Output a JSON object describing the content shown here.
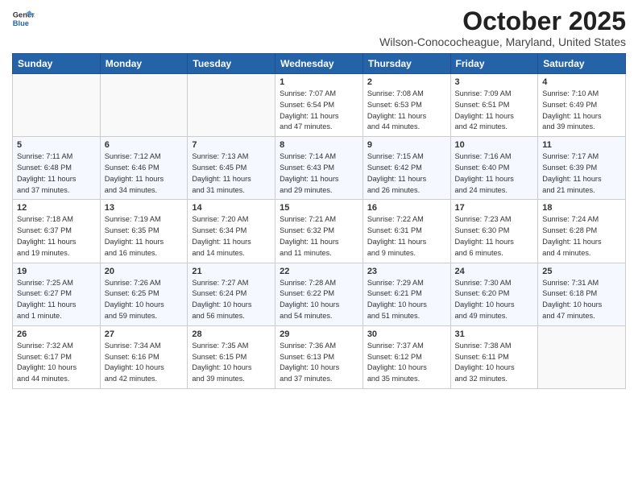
{
  "header": {
    "logo": {
      "line1": "General",
      "line2": "Blue"
    },
    "month": "October 2025",
    "location": "Wilson-Conococheague, Maryland, United States"
  },
  "days_of_week": [
    "Sunday",
    "Monday",
    "Tuesday",
    "Wednesday",
    "Thursday",
    "Friday",
    "Saturday"
  ],
  "weeks": [
    [
      {
        "day": "",
        "info": ""
      },
      {
        "day": "",
        "info": ""
      },
      {
        "day": "",
        "info": ""
      },
      {
        "day": "1",
        "info": "Sunrise: 7:07 AM\nSunset: 6:54 PM\nDaylight: 11 hours\nand 47 minutes."
      },
      {
        "day": "2",
        "info": "Sunrise: 7:08 AM\nSunset: 6:53 PM\nDaylight: 11 hours\nand 44 minutes."
      },
      {
        "day": "3",
        "info": "Sunrise: 7:09 AM\nSunset: 6:51 PM\nDaylight: 11 hours\nand 42 minutes."
      },
      {
        "day": "4",
        "info": "Sunrise: 7:10 AM\nSunset: 6:49 PM\nDaylight: 11 hours\nand 39 minutes."
      }
    ],
    [
      {
        "day": "5",
        "info": "Sunrise: 7:11 AM\nSunset: 6:48 PM\nDaylight: 11 hours\nand 37 minutes."
      },
      {
        "day": "6",
        "info": "Sunrise: 7:12 AM\nSunset: 6:46 PM\nDaylight: 11 hours\nand 34 minutes."
      },
      {
        "day": "7",
        "info": "Sunrise: 7:13 AM\nSunset: 6:45 PM\nDaylight: 11 hours\nand 31 minutes."
      },
      {
        "day": "8",
        "info": "Sunrise: 7:14 AM\nSunset: 6:43 PM\nDaylight: 11 hours\nand 29 minutes."
      },
      {
        "day": "9",
        "info": "Sunrise: 7:15 AM\nSunset: 6:42 PM\nDaylight: 11 hours\nand 26 minutes."
      },
      {
        "day": "10",
        "info": "Sunrise: 7:16 AM\nSunset: 6:40 PM\nDaylight: 11 hours\nand 24 minutes."
      },
      {
        "day": "11",
        "info": "Sunrise: 7:17 AM\nSunset: 6:39 PM\nDaylight: 11 hours\nand 21 minutes."
      }
    ],
    [
      {
        "day": "12",
        "info": "Sunrise: 7:18 AM\nSunset: 6:37 PM\nDaylight: 11 hours\nand 19 minutes."
      },
      {
        "day": "13",
        "info": "Sunrise: 7:19 AM\nSunset: 6:35 PM\nDaylight: 11 hours\nand 16 minutes."
      },
      {
        "day": "14",
        "info": "Sunrise: 7:20 AM\nSunset: 6:34 PM\nDaylight: 11 hours\nand 14 minutes."
      },
      {
        "day": "15",
        "info": "Sunrise: 7:21 AM\nSunset: 6:32 PM\nDaylight: 11 hours\nand 11 minutes."
      },
      {
        "day": "16",
        "info": "Sunrise: 7:22 AM\nSunset: 6:31 PM\nDaylight: 11 hours\nand 9 minutes."
      },
      {
        "day": "17",
        "info": "Sunrise: 7:23 AM\nSunset: 6:30 PM\nDaylight: 11 hours\nand 6 minutes."
      },
      {
        "day": "18",
        "info": "Sunrise: 7:24 AM\nSunset: 6:28 PM\nDaylight: 11 hours\nand 4 minutes."
      }
    ],
    [
      {
        "day": "19",
        "info": "Sunrise: 7:25 AM\nSunset: 6:27 PM\nDaylight: 11 hours\nand 1 minute."
      },
      {
        "day": "20",
        "info": "Sunrise: 7:26 AM\nSunset: 6:25 PM\nDaylight: 10 hours\nand 59 minutes."
      },
      {
        "day": "21",
        "info": "Sunrise: 7:27 AM\nSunset: 6:24 PM\nDaylight: 10 hours\nand 56 minutes."
      },
      {
        "day": "22",
        "info": "Sunrise: 7:28 AM\nSunset: 6:22 PM\nDaylight: 10 hours\nand 54 minutes."
      },
      {
        "day": "23",
        "info": "Sunrise: 7:29 AM\nSunset: 6:21 PM\nDaylight: 10 hours\nand 51 minutes."
      },
      {
        "day": "24",
        "info": "Sunrise: 7:30 AM\nSunset: 6:20 PM\nDaylight: 10 hours\nand 49 minutes."
      },
      {
        "day": "25",
        "info": "Sunrise: 7:31 AM\nSunset: 6:18 PM\nDaylight: 10 hours\nand 47 minutes."
      }
    ],
    [
      {
        "day": "26",
        "info": "Sunrise: 7:32 AM\nSunset: 6:17 PM\nDaylight: 10 hours\nand 44 minutes."
      },
      {
        "day": "27",
        "info": "Sunrise: 7:34 AM\nSunset: 6:16 PM\nDaylight: 10 hours\nand 42 minutes."
      },
      {
        "day": "28",
        "info": "Sunrise: 7:35 AM\nSunset: 6:15 PM\nDaylight: 10 hours\nand 39 minutes."
      },
      {
        "day": "29",
        "info": "Sunrise: 7:36 AM\nSunset: 6:13 PM\nDaylight: 10 hours\nand 37 minutes."
      },
      {
        "day": "30",
        "info": "Sunrise: 7:37 AM\nSunset: 6:12 PM\nDaylight: 10 hours\nand 35 minutes."
      },
      {
        "day": "31",
        "info": "Sunrise: 7:38 AM\nSunset: 6:11 PM\nDaylight: 10 hours\nand 32 minutes."
      },
      {
        "day": "",
        "info": ""
      }
    ]
  ]
}
